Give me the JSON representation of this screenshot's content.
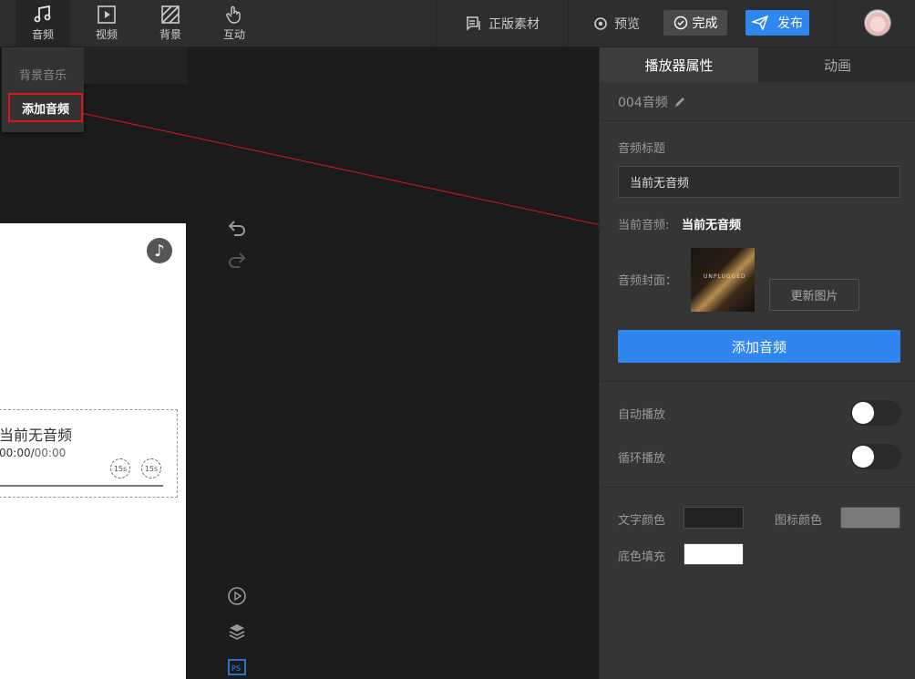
{
  "toolbar": {
    "tools": [
      {
        "label": "音频",
        "icon": "music-note-icon"
      },
      {
        "label": "视频",
        "icon": "video-icon"
      },
      {
        "label": "背景",
        "icon": "background-icon"
      },
      {
        "label": "互动",
        "icon": "hand-touch-icon"
      }
    ],
    "licensed_material": "正版素材",
    "preview": "预览",
    "done": "完成",
    "publish": "发布"
  },
  "audio_menu": {
    "background_music": "背景音乐",
    "add_audio": "添加音频"
  },
  "canvas": {
    "player_title": "当前无音频",
    "time_current": "00:00",
    "time_sep": "/",
    "time_total": "00:00",
    "skip_back": "15s",
    "skip_forward": "15s"
  },
  "panel": {
    "tabs": [
      "播放器属性",
      "动画"
    ],
    "component_name": "004音频",
    "audio_title_label": "音频标题",
    "audio_title_value": "当前无音频",
    "current_audio_label": "当前音频:",
    "current_audio_value": "当前无音频",
    "cover_label": "音频封面：",
    "cover_text": "UNPLUGGED",
    "change_image": "更新图片",
    "add_audio": "添加音频",
    "autoplay_label": "自动播放",
    "autoplay": false,
    "loop_label": "循环播放",
    "loop": false,
    "text_color_label": "文字颜色",
    "text_color": "#222222",
    "icon_color_label": "图标颜色",
    "icon_color": "#7a7a7a",
    "fill_label": "底色填充",
    "fill_color": "#ffffff"
  },
  "colors": {
    "accent": "#2e86ee",
    "highlight": "#d9161b"
  }
}
